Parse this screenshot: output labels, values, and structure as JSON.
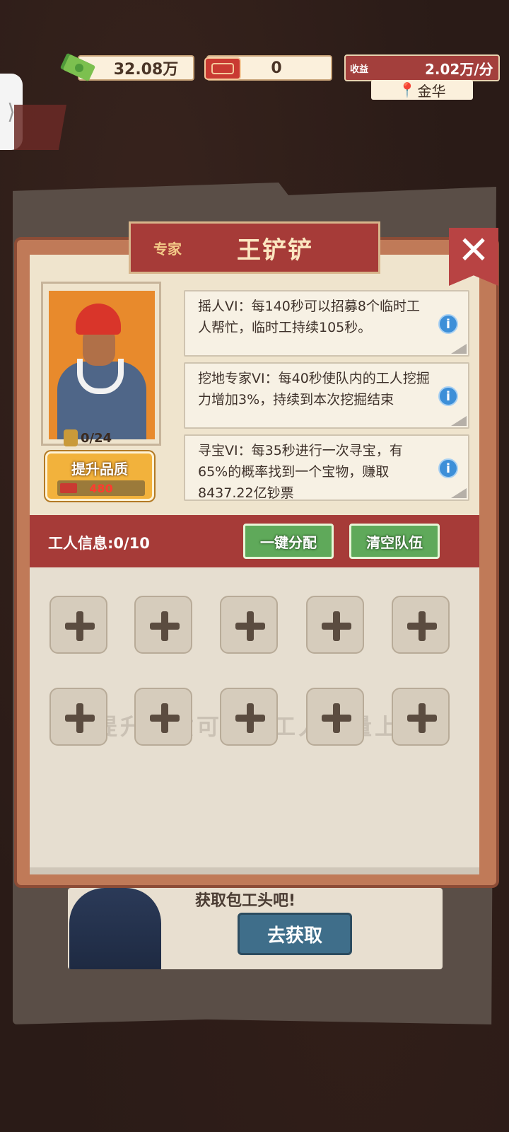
{
  "top_bar": {
    "money": "32.08万",
    "tickets": "0",
    "income_label": "收益",
    "income_value": "2.02万/分",
    "location": "金华"
  },
  "background": {
    "prompt_text": "获取包工头吧!",
    "go_get_button": "去获取"
  },
  "modal": {
    "title_sub": "专家",
    "title_name": "王铲铲",
    "close_icon": "close-icon",
    "portrait_count": "0/24",
    "upgrade_label": "提升品质",
    "upgrade_cost": "480",
    "skills": [
      {
        "text": "摇人VI：每140秒可以招募8个临时工人帮忙，临时工持续105秒。"
      },
      {
        "text": "挖地专家VI：每40秒使队内的工人挖掘力增加3%，持续到本次挖掘结束"
      },
      {
        "text": "寻宝VI：每35秒进行一次寻宝，有65%的概率找到一个宝物，赚取8437.22亿钞票"
      }
    ],
    "worker_info": "工人信息:0/10",
    "auto_assign": "一键分配",
    "clear_team": "清空队伍",
    "hint": "提升品质可增加工人数量上限",
    "slot_count": 10
  },
  "colors": {
    "accent_red": "#a63b38",
    "panel_cream": "#efe4cd",
    "green_button": "#5fa95a",
    "upgrade_gold": "#f2b23c"
  }
}
